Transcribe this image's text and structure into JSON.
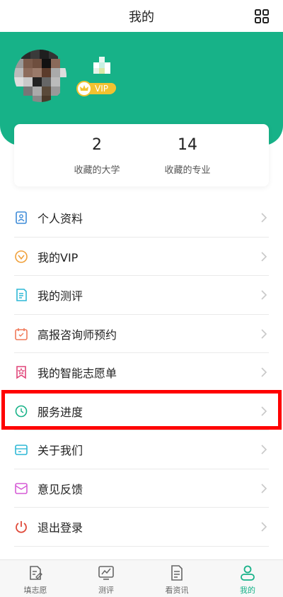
{
  "header": {
    "title": "我的"
  },
  "profile": {
    "vip_label": "VIP"
  },
  "stats": [
    {
      "value": "2",
      "label": "收藏的大学"
    },
    {
      "value": "14",
      "label": "收藏的专业"
    }
  ],
  "menu": [
    {
      "label": "个人资料",
      "icon": "profile-icon",
      "color": "#3d8bd8"
    },
    {
      "label": "我的VIP",
      "icon": "vip-icon",
      "color": "#f0a03a"
    },
    {
      "label": "我的测评",
      "icon": "assessment-icon",
      "color": "#2fb8d6"
    },
    {
      "label": "高报咨询师预约",
      "icon": "appointment-icon",
      "color": "#f07a5a"
    },
    {
      "label": "我的智能志愿单",
      "icon": "wishlist-icon",
      "color": "#e0467a"
    },
    {
      "label": "服务进度",
      "icon": "progress-icon",
      "color": "#17b288"
    },
    {
      "label": "关于我们",
      "icon": "about-icon",
      "color": "#2fb8d6"
    },
    {
      "label": "意见反馈",
      "icon": "feedback-icon",
      "color": "#d65bd6"
    },
    {
      "label": "退出登录",
      "icon": "logout-icon",
      "color": "#e04a3a"
    }
  ],
  "tabs": [
    {
      "label": "填志愿",
      "active": false
    },
    {
      "label": "测评",
      "active": false
    },
    {
      "label": "看资讯",
      "active": false
    },
    {
      "label": "我的",
      "active": true
    }
  ],
  "colors": {
    "brand": "#17b288",
    "highlight": "#ff0000",
    "vip": "#f2c230"
  }
}
